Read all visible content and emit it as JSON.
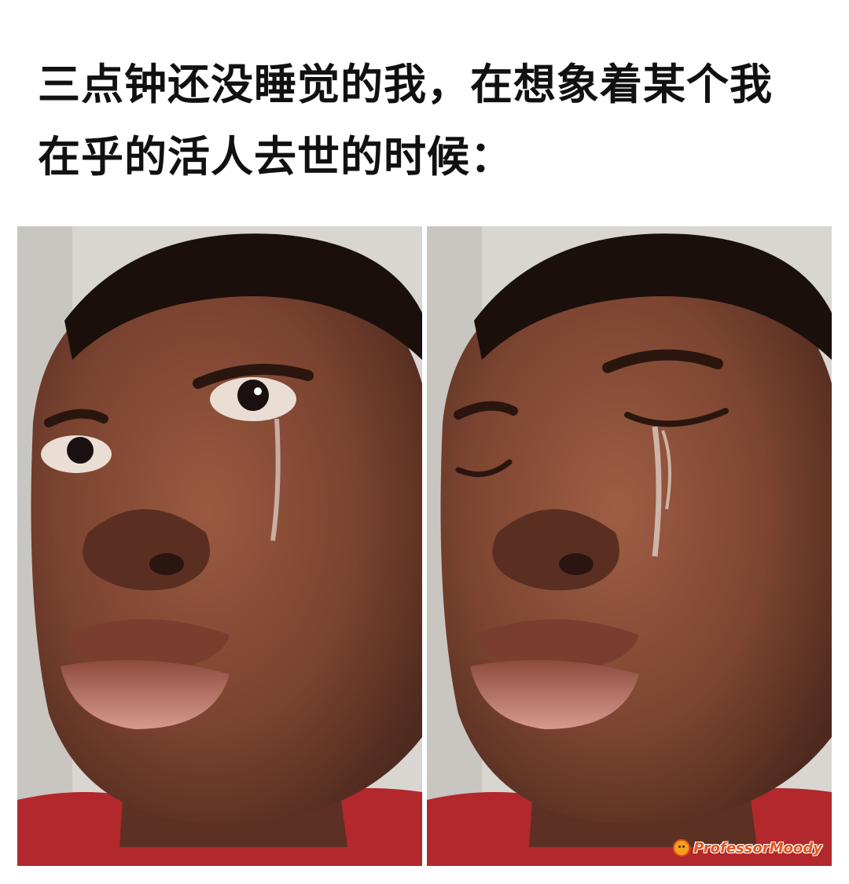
{
  "caption": {
    "line1": "三点钟还没睡觉的我，在想象着某个我",
    "line2": "在乎的活人去世的时候："
  },
  "panels": [
    {
      "expression": "eyes-open-teary"
    },
    {
      "expression": "eyes-closed-crying"
    }
  ],
  "watermark": {
    "text": "ProfessorMoody",
    "icon": "sad-face-icon"
  },
  "colors": {
    "text": "#111111",
    "background": "#ffffff",
    "skin": "#7a4230",
    "shirt": "#b2282c",
    "wall": "#d9d6d2",
    "watermark": "#e2521b"
  }
}
